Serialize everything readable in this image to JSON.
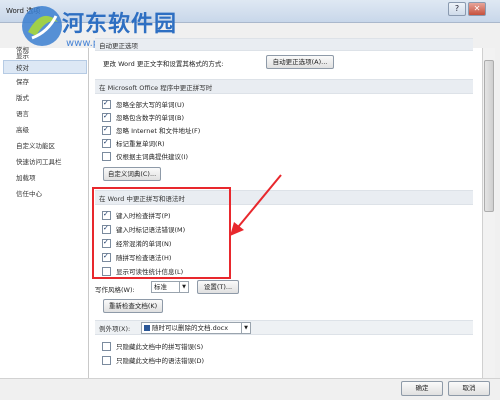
{
  "window": {
    "title": "Word 选项",
    "help": "?",
    "close": "✕"
  },
  "logo": {
    "text": "河东软件园",
    "url": "www.pc0359.cn"
  },
  "sidebar": {
    "items": [
      {
        "label": "常规"
      },
      {
        "label": "显示"
      },
      {
        "label": "校对"
      },
      {
        "label": "保存"
      },
      {
        "label": "版式"
      },
      {
        "label": "语言"
      },
      {
        "label": "高级"
      },
      {
        "label": "自定义功能区"
      },
      {
        "label": "快速访问工具栏"
      },
      {
        "label": "加载项"
      },
      {
        "label": "信任中心"
      }
    ]
  },
  "autocorrect": {
    "header": "自动更正选项",
    "desc": "更改 Word 更正文字和设置其格式的方式:",
    "button": "自动更正选项(A)..."
  },
  "office_section": {
    "header": "在 Microsoft Office 程序中更正拼写时",
    "options": [
      {
        "label": "忽略全部大写的单词(U)",
        "checked": true
      },
      {
        "label": "忽略包含数字的单词(B)",
        "checked": true
      },
      {
        "label": "忽略 Internet 和文件地址(F)",
        "checked": true
      },
      {
        "label": "标记重复单词(R)",
        "checked": true
      },
      {
        "label": "仅根据主词典提供建议(I)",
        "checked": false
      }
    ],
    "dict_button": "自定义词典(C)..."
  },
  "word_section": {
    "header": "在 Word 中更正拼写和语法时",
    "options": [
      {
        "label": "键入时检查拼写(P)",
        "checked": true
      },
      {
        "label": "键入时标记语法错误(M)",
        "checked": true
      },
      {
        "label": "经常混淆的单词(N)",
        "checked": true
      },
      {
        "label": "随拼写检查语法(H)",
        "checked": true
      },
      {
        "label": "显示可读性统计信息(L)",
        "checked": false
      }
    ],
    "style_label": "写作风格(W):",
    "style_value": "标准",
    "settings_button": "设置(T)...",
    "recheck_button": "重新检查文档(K)"
  },
  "exceptions": {
    "label": "例外项(X):",
    "doc_value": "随时可以删除的文档.docx",
    "options": [
      {
        "label": "只隐藏此文档中的拼写错误(S)",
        "checked": false
      },
      {
        "label": "只隐藏此文档中的语法错误(D)",
        "checked": false
      }
    ]
  },
  "footer": {
    "ok": "确定",
    "cancel": "取消"
  },
  "colors": {
    "highlight": "#e8282d",
    "logo": "#2e6fc2"
  }
}
